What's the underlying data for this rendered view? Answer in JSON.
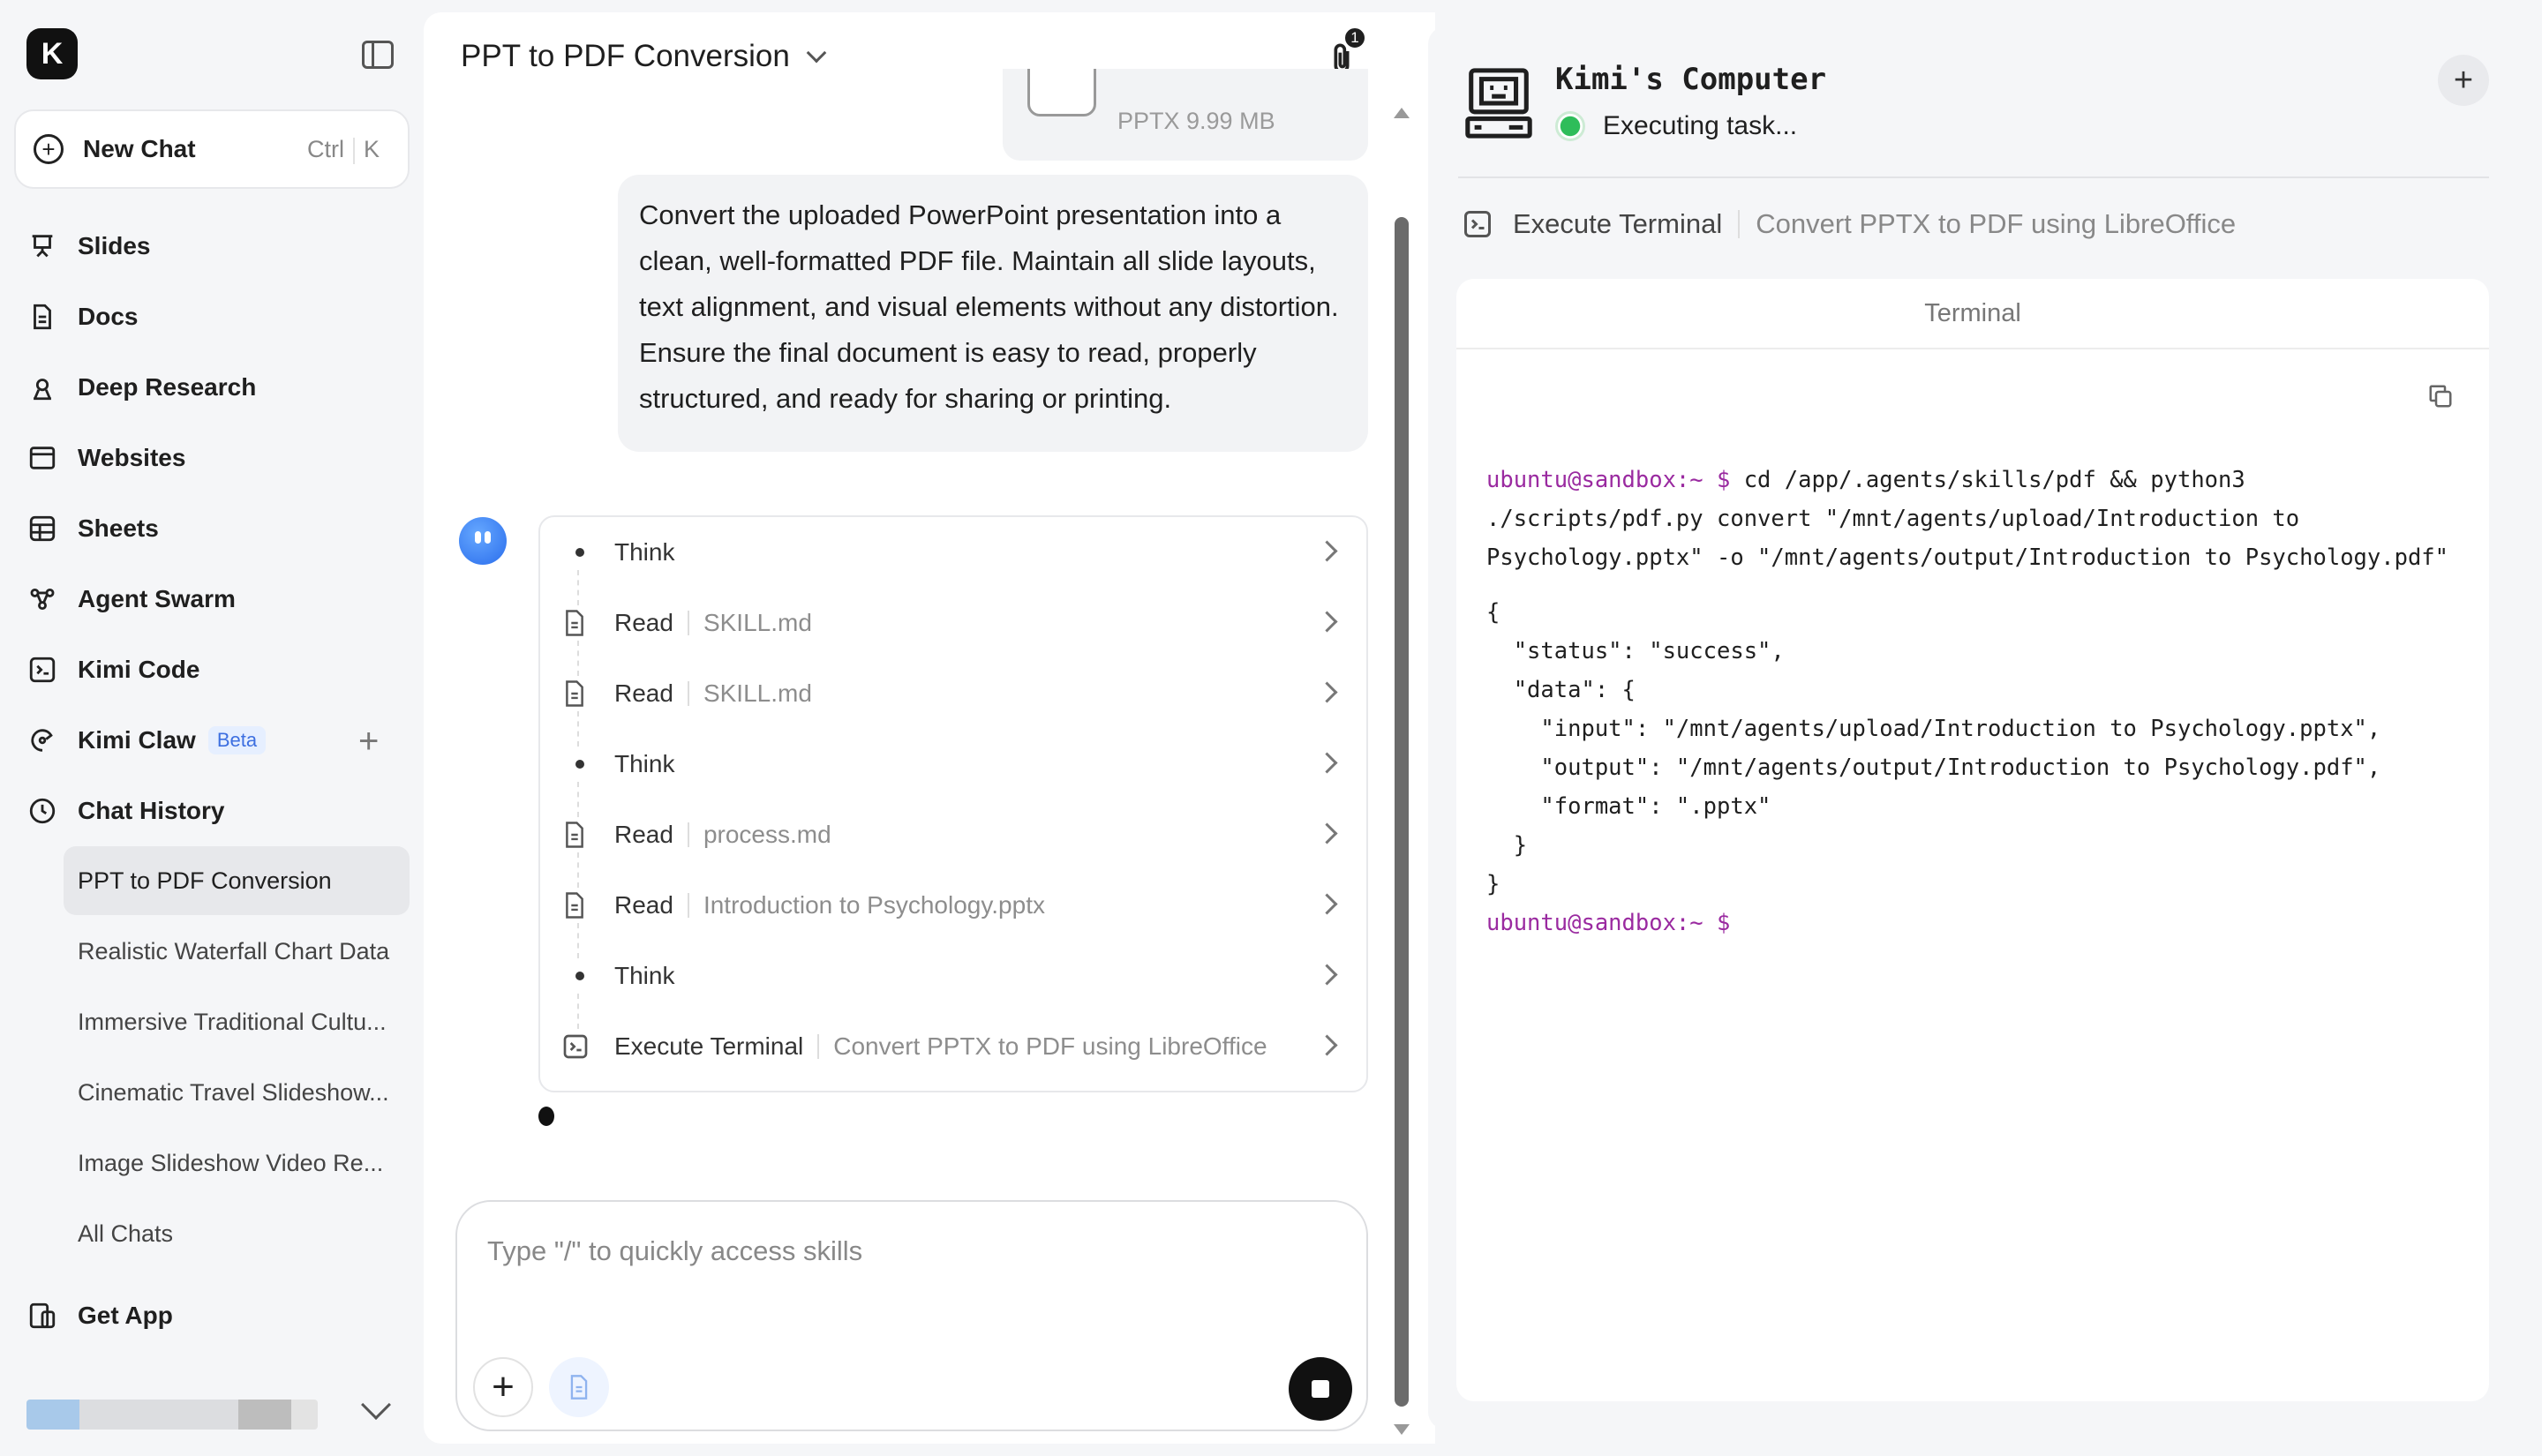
{
  "sidebar": {
    "logo": "K",
    "new_chat": {
      "label": "New Chat",
      "key1": "Ctrl",
      "key2": "K"
    },
    "nav": [
      {
        "label": "Slides",
        "icon": "slides-icon"
      },
      {
        "label": "Docs",
        "icon": "docs-icon"
      },
      {
        "label": "Deep Research",
        "icon": "deep-research-icon"
      },
      {
        "label": "Websites",
        "icon": "websites-icon"
      },
      {
        "label": "Sheets",
        "icon": "sheets-icon"
      },
      {
        "label": "Agent Swarm",
        "icon": "agent-swarm-icon"
      },
      {
        "label": "Kimi Code",
        "icon": "code-icon"
      },
      {
        "label": "Kimi Claw",
        "icon": "claw-icon",
        "badge": "Beta"
      },
      {
        "label": "Chat History",
        "icon": "clock-icon"
      }
    ],
    "history": [
      {
        "label": "PPT to PDF Conversion",
        "active": true
      },
      {
        "label": "Realistic Waterfall Chart Data"
      },
      {
        "label": "Immersive Traditional Cultu..."
      },
      {
        "label": "Cinematic Travel Slideshow..."
      },
      {
        "label": "Image Slideshow Video Re..."
      },
      {
        "label": "All Chats"
      }
    ],
    "get_app": "Get App"
  },
  "chat": {
    "title": "PPT to PDF Conversion",
    "attachment_count": "1",
    "file": {
      "meta": "PPTX 9.99 MB"
    },
    "user_message": "Convert the uploaded PowerPoint presentation into a clean, well-formatted PDF file. Maintain all slide layouts, text alignment, and visual elements without any distortion. Ensure the final document is easy to read, properly structured, and ready for sharing or printing.",
    "steps": [
      {
        "verb": "Think",
        "arg": "",
        "icon": "dot"
      },
      {
        "verb": "Read",
        "arg": "SKILL.md",
        "icon": "file-icon"
      },
      {
        "verb": "Read",
        "arg": "SKILL.md",
        "icon": "file-icon"
      },
      {
        "verb": "Think",
        "arg": "",
        "icon": "dot"
      },
      {
        "verb": "Read",
        "arg": "process.md",
        "icon": "file-icon"
      },
      {
        "verb": "Read",
        "arg": "Introduction to Psychology.pptx",
        "icon": "file-icon"
      },
      {
        "verb": "Think",
        "arg": "",
        "icon": "dot"
      },
      {
        "verb": "Execute Terminal",
        "arg": "Convert PPTX to PDF using LibreOffice",
        "icon": "terminal-icon"
      }
    ],
    "composer_placeholder": "Type \"/\" to quickly access skills"
  },
  "computer": {
    "title": "Kimi's Computer",
    "status": "Executing task...",
    "exec_verb": "Execute Terminal",
    "exec_arg": "Convert PPTX to PDF using LibreOffice",
    "terminal_header": "Terminal",
    "terminal": {
      "prompt": "ubuntu@sandbox:~ $",
      "command": " cd /app/.agents/skills/pdf && python3\n./scripts/pdf.py convert \"/mnt/agents/upload/Introduction to\nPsychology.pptx\" -o \"/mnt/agents/output/Introduction to Psychology.pdf\"",
      "output": "{\n  \"status\": \"success\",\n  \"data\": {\n    \"input\": \"/mnt/agents/upload/Introduction to Psychology.pptx\",\n    \"output\": \"/mnt/agents/output/Introduction to Psychology.pdf\",\n    \"format\": \".pptx\"\n  }\n}",
      "final_prompt": "ubuntu@sandbox:~ $"
    }
  }
}
